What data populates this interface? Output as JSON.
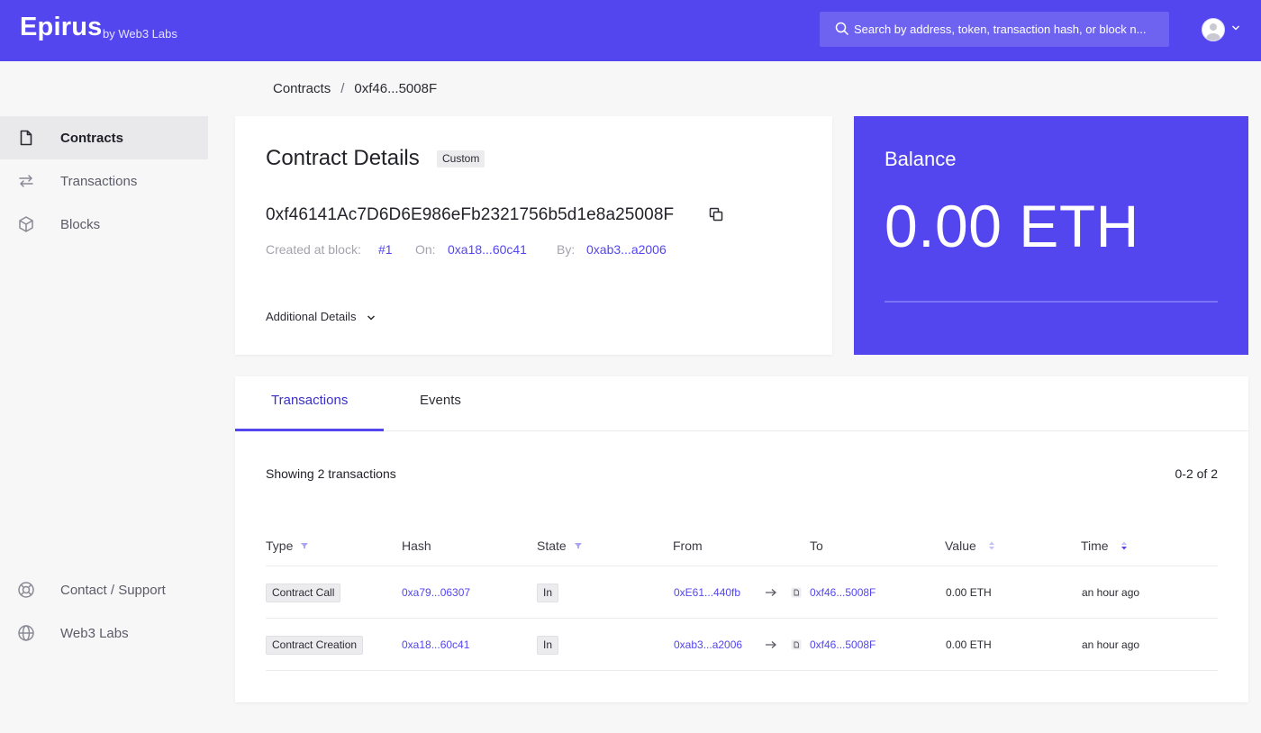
{
  "header": {
    "logo": "Epirus",
    "logo_sub": "by Web3 Labs",
    "search_placeholder": "Search by address, token, transaction hash, or block n...",
    "avatar_icon": "user-avatar-icon",
    "accent_color": "#5346ef"
  },
  "breadcrumb": {
    "parent": "Contracts",
    "separator": "/",
    "current": "0xf46...5008F"
  },
  "sidebar": {
    "items": [
      {
        "label": "Contracts",
        "icon": "document-icon",
        "active": true
      },
      {
        "label": "Transactions",
        "icon": "arrows-swap-icon",
        "active": false
      },
      {
        "label": "Blocks",
        "icon": "cube-icon",
        "active": false
      }
    ],
    "footer": [
      {
        "label": "Contact / Support",
        "icon": "lifebuoy-icon"
      },
      {
        "label": "Web3 Labs",
        "icon": "globe-icon"
      }
    ]
  },
  "contract": {
    "title": "Contract Details",
    "badge": "Custom",
    "address": "0xf46141Ac7D6D6E986eFb2321756b5d1e8a25008F",
    "created_label": "Created at block:",
    "created_block": "#1",
    "on_label": "On:",
    "on_tx": "0xa18...60c41",
    "by_label": "By:",
    "by_addr": "0xab3...a2006",
    "additional": "Additional Details"
  },
  "balance": {
    "title": "Balance",
    "value": "0.00 ETH"
  },
  "tabs": {
    "items": [
      {
        "label": "Transactions",
        "active": true
      },
      {
        "label": "Events",
        "active": false
      }
    ]
  },
  "transactions": {
    "showing": "Showing 2 transactions",
    "range": "0-2 of 2",
    "columns": [
      "Type",
      "Hash",
      "State",
      "From",
      "To",
      "Value",
      "Time"
    ],
    "rows": [
      {
        "type": "Contract Call",
        "hash": "0xa79...06307",
        "state": "In",
        "from": "0xE61...440fb",
        "to": "0xf46...5008F",
        "value": "0.00 ETH",
        "time": "an hour ago"
      },
      {
        "type": "Contract Creation",
        "hash": "0xa18...60c41",
        "state": "In",
        "from": "0xab3...a2006",
        "to": "0xf46...5008F",
        "value": "0.00 ETH",
        "time": "an hour ago"
      }
    ]
  }
}
